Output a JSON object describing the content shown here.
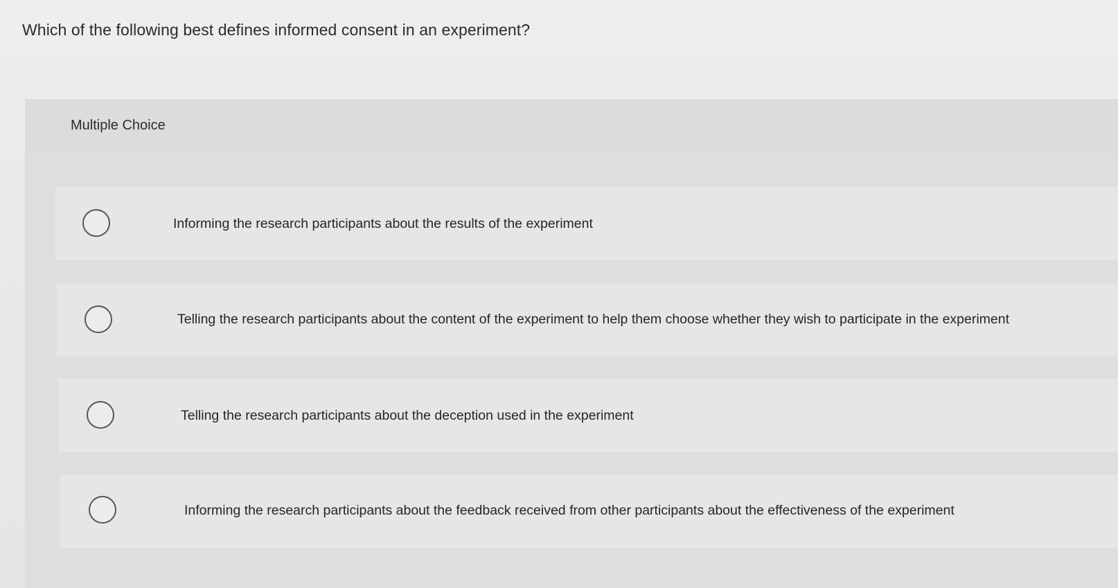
{
  "question": {
    "text": "Which of the following best defines informed consent in an experiment?"
  },
  "panel": {
    "title": "Multiple Choice"
  },
  "options": [
    {
      "label": "Informing the research participants about the results of the experiment",
      "selected": false
    },
    {
      "label": "Telling the research participants about the content of the experiment to help them choose whether they wish to participate in the experiment",
      "selected": false
    },
    {
      "label": "Telling the research participants about the deception used in the experiment",
      "selected": false
    },
    {
      "label": "Informing the research participants about the feedback received from other participants about the effectiveness of the experiment",
      "selected": false
    }
  ],
  "icons": {
    "radio": "radio-unselected-icon"
  }
}
